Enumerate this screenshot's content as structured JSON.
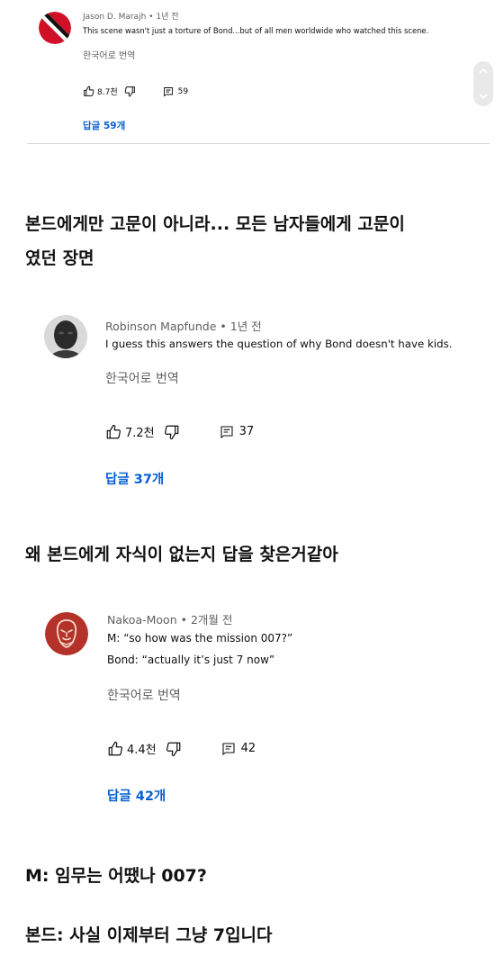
{
  "comments": [
    {
      "author": "Jason D. Marajh",
      "time": "• 1년 전",
      "text": "This scene wasn't just a torture of Bond...but of all men worldwide who watched this scene.",
      "translate": "한국어로 번역",
      "likes": "8.7천",
      "reply_count": "59",
      "replies_link": "답글 59개"
    },
    {
      "author": "Robinson Mapfunde",
      "time": "• 1년 전",
      "text": "I guess this answers the question of why Bond doesn't have kids.",
      "translate": "한국어로 번역",
      "likes": "7.2천",
      "reply_count": "37",
      "replies_link": "답글 37개"
    },
    {
      "author": "Nakoa-Moon",
      "time": "• 2개월 전",
      "text_line1": "M: “so how was the mission 007?”",
      "text_line2": "Bond: “actually it’s just 7 now”",
      "translate": "한국어로 번역",
      "likes": "4.4천",
      "reply_count": "42",
      "replies_link": "답글 42개"
    }
  ],
  "captions": {
    "c1_line1": "본드에게만 고문이 아니라... 모든 남자들에게 고문이",
    "c1_line2": "였던 장면",
    "c2": "왜 본드에게 자식이 없는지 답을 찾은거같아",
    "c3_line1": "M: 임무는 어땠나 007?",
    "c3_line2": "본드: 사실 이제부터 그냥 7입니다"
  },
  "colors": {
    "link_blue": "#065fd4",
    "meta_gray": "#606060",
    "avatar_tt_red": "#ce1126",
    "avatar_nakoa_red": "#b4322a"
  },
  "icons": [
    "thumbs-up-icon",
    "thumbs-down-icon",
    "reply-comment-icon",
    "scroll-up-icon",
    "scroll-down-icon"
  ]
}
